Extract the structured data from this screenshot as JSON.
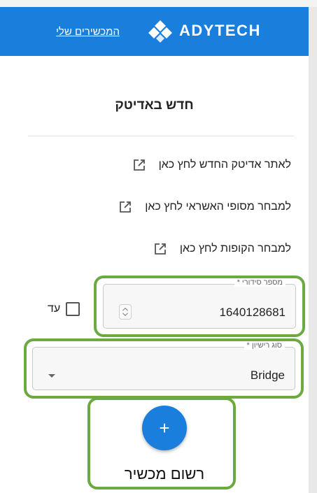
{
  "header": {
    "brand": "ADYTECH",
    "my_devices": "המכשירים שלי",
    "bg_color": "#1a7fdc"
  },
  "news": {
    "title": "חדש באדיטק",
    "links": [
      {
        "label": "לאתר אדיטק החדש לחץ כאן",
        "icon": "external-link-icon"
      },
      {
        "label": "למבחר מסופי האשראי לחץ כאן",
        "icon": "external-link-icon"
      },
      {
        "label": "למבחר הקופות לחץ כאן",
        "icon": "external-link-icon"
      }
    ]
  },
  "form": {
    "serial_label": "מספר סידורי *",
    "serial_value": "1640128681",
    "until_label": "עד",
    "until_checked": false,
    "license_label": "סוג רישיון *",
    "license_value": "Bridge"
  },
  "register": {
    "button_icon": "+",
    "label": "רשום מכשיר"
  },
  "highlight_color": "#6aaa40"
}
